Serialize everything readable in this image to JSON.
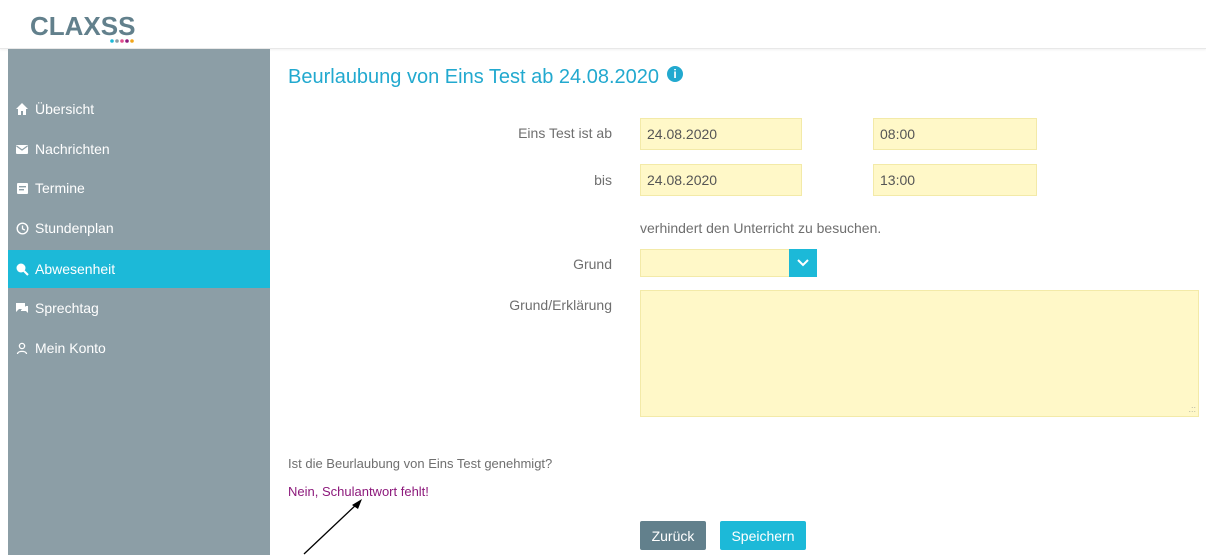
{
  "app": {
    "logo_text": "CLAXSS",
    "logo_colors": [
      "#1cb9d8",
      "#8c9ea6",
      "#e14d8e",
      "#8d1a7c",
      "#f2a61a"
    ]
  },
  "sidebar": {
    "items": [
      {
        "label": "Übersicht",
        "icon": "home-icon",
        "active": false
      },
      {
        "label": "Nachrichten",
        "icon": "envelope-icon",
        "active": false
      },
      {
        "label": "Termine",
        "icon": "calendar-note-icon",
        "active": false
      },
      {
        "label": "Stundenplan",
        "icon": "clock-icon",
        "active": false
      },
      {
        "label": "Abwesenheit",
        "icon": "absence-icon",
        "active": true
      },
      {
        "label": "Sprechtag",
        "icon": "chat-icon",
        "active": false
      },
      {
        "label": "Mein Konto",
        "icon": "user-icon",
        "active": false
      }
    ]
  },
  "page": {
    "title": "Beurlaubung von Eins Test ab 24.08.2020",
    "info_icon_glyph": "i"
  },
  "form": {
    "from_label": "Eins Test ist ab",
    "from_date": "24.08.2020",
    "from_time": "08:00",
    "to_label": "bis",
    "to_date": "24.08.2020",
    "to_time": "13:00",
    "note": "verhindert den Unterricht zu besuchen.",
    "reason_label": "Grund",
    "reason_value": "",
    "explanation_label": "Grund/Erklärung",
    "explanation_value": ""
  },
  "approval": {
    "question": "Ist die Beurlaubung von Eins Test genehmigt?",
    "answer": "Nein, Schulantwort fehlt!"
  },
  "buttons": {
    "back": "Zurück",
    "save": "Speichern"
  },
  "colors": {
    "accent": "#1cb9d8",
    "sidebar_bg": "#8c9ea6",
    "field_bg": "#fff8c8",
    "answer_text": "#8d1a7c",
    "back_button": "#62808c"
  }
}
